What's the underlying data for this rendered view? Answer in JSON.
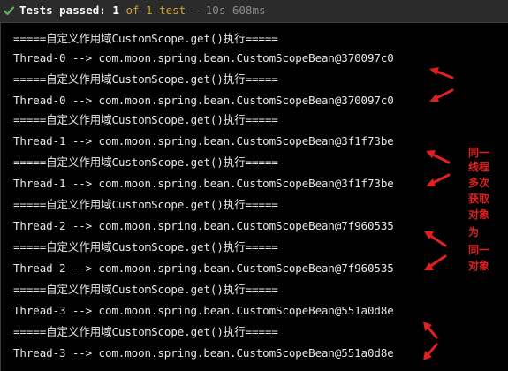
{
  "test_status": {
    "label": "Tests passed:",
    "passed": "1",
    "of_text": "of 1 test",
    "separator": "–",
    "duration": "10s 608ms",
    "accent_color": "#d4a12b",
    "icon": "check-icon"
  },
  "console": {
    "lines": [
      "=====自定义作用域CustomScope.get()执行=====",
      "Thread-0 --> com.moon.spring.bean.CustomScopeBean@370097c0",
      "=====自定义作用域CustomScope.get()执行=====",
      "Thread-0 --> com.moon.spring.bean.CustomScopeBean@370097c0",
      "=====自定义作用域CustomScope.get()执行=====",
      "Thread-1 --> com.moon.spring.bean.CustomScopeBean@3f1f73be",
      "=====自定义作用域CustomScope.get()执行=====",
      "Thread-1 --> com.moon.spring.bean.CustomScopeBean@3f1f73be",
      "=====自定义作用域CustomScope.get()执行=====",
      "Thread-2 --> com.moon.spring.bean.CustomScopeBean@7f960535",
      "=====自定义作用域CustomScope.get()执行=====",
      "Thread-2 --> com.moon.spring.bean.CustomScopeBean@7f960535",
      "=====自定义作用域CustomScope.get()执行=====",
      "Thread-3 --> com.moon.spring.bean.CustomScopeBean@551a0d8e",
      "=====自定义作用域CustomScope.get()执行=====",
      "Thread-3 --> com.moon.spring.bean.CustomScopeBean@551a0d8e"
    ]
  },
  "annotation": {
    "color": "#e02020",
    "note_lines": [
      "同一",
      "线程",
      "多次",
      "获取",
      "对象",
      "为",
      "同一",
      "对象"
    ]
  }
}
